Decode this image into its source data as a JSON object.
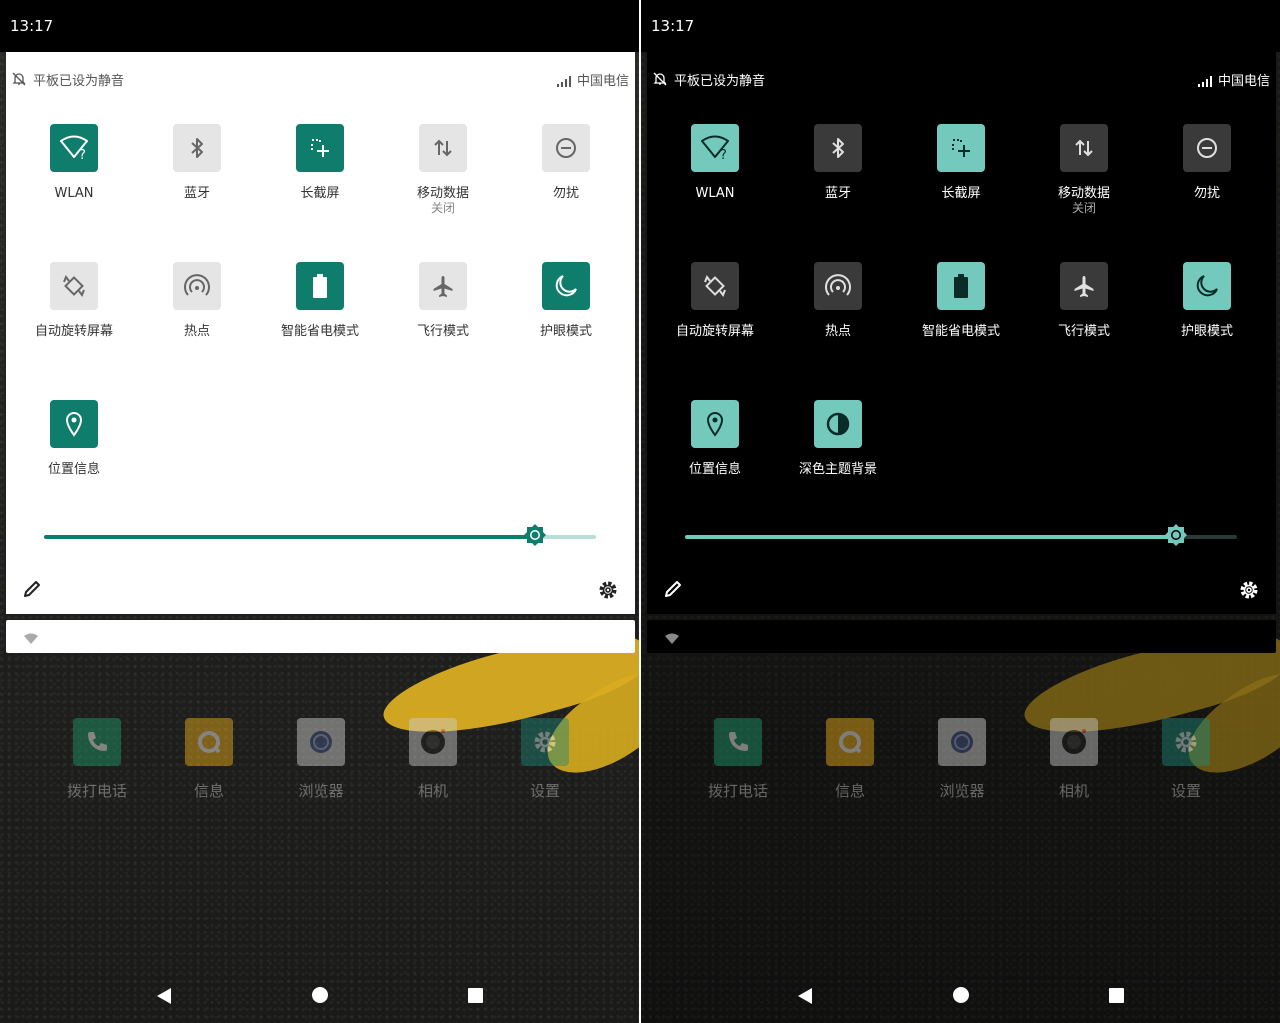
{
  "colors": {
    "accent_light": "#0f7d6b",
    "accent_dark": "#74c9bd"
  },
  "panels": [
    {
      "theme": "light",
      "status": {
        "time": "13:17"
      },
      "qs": {
        "silent_text": "平板已设为静音",
        "carrier": "中国电信"
      },
      "tiles": [
        {
          "label": "WLAN",
          "icon": "wifi-question-icon",
          "state": "on"
        },
        {
          "label": "蓝牙",
          "icon": "bluetooth-icon",
          "state": "off"
        },
        {
          "label": "长截屏",
          "icon": "long-screenshot-icon",
          "state": "on"
        },
        {
          "label": "移动数据",
          "sub": "关闭",
          "icon": "mobile-data-icon",
          "state": "off"
        },
        {
          "label": "勿扰",
          "icon": "do-not-disturb-icon",
          "state": "off"
        },
        {
          "label": "自动旋转屏幕",
          "icon": "auto-rotate-icon",
          "state": "off"
        },
        {
          "label": "热点",
          "icon": "hotspot-icon",
          "state": "off"
        },
        {
          "label": "智能省电模式",
          "icon": "battery-saver-icon",
          "state": "on"
        },
        {
          "label": "飞行模式",
          "icon": "airplane-icon",
          "state": "off"
        },
        {
          "label": "护眼模式",
          "icon": "night-mode-icon",
          "state": "on"
        },
        {
          "label": "位置信息",
          "icon": "location-icon",
          "state": "on"
        }
      ],
      "brightness": 0.89,
      "dock": [
        {
          "label": "拨打电话",
          "icon": "phone-icon",
          "color": "#1f9e6e"
        },
        {
          "label": "信息",
          "icon": "message-icon",
          "color": "#f3b21a"
        },
        {
          "label": "浏览器",
          "icon": "browser-icon",
          "color": "#d8d8d8"
        },
        {
          "label": "相机",
          "icon": "camera-icon",
          "color": "#cfcfcf"
        },
        {
          "label": "设置",
          "icon": "settings-icon",
          "color": "#1d8a7a"
        }
      ]
    },
    {
      "theme": "dark",
      "status": {
        "time": "13:17"
      },
      "qs": {
        "silent_text": "平板已设为静音",
        "carrier": "中国电信"
      },
      "tiles": [
        {
          "label": "WLAN",
          "icon": "wifi-question-icon",
          "state": "on"
        },
        {
          "label": "蓝牙",
          "icon": "bluetooth-icon",
          "state": "off"
        },
        {
          "label": "长截屏",
          "icon": "long-screenshot-icon",
          "state": "on"
        },
        {
          "label": "移动数据",
          "sub": "关闭",
          "icon": "mobile-data-icon",
          "state": "off"
        },
        {
          "label": "勿扰",
          "icon": "do-not-disturb-icon",
          "state": "off"
        },
        {
          "label": "自动旋转屏幕",
          "icon": "auto-rotate-icon",
          "state": "off"
        },
        {
          "label": "热点",
          "icon": "hotspot-icon",
          "state": "off"
        },
        {
          "label": "智能省电模式",
          "icon": "battery-saver-icon",
          "state": "on"
        },
        {
          "label": "飞行模式",
          "icon": "airplane-icon",
          "state": "off"
        },
        {
          "label": "护眼模式",
          "icon": "night-mode-icon",
          "state": "on"
        },
        {
          "label": "位置信息",
          "icon": "location-icon",
          "state": "on"
        },
        {
          "label": "深色主题背景",
          "icon": "dark-theme-icon",
          "state": "on"
        }
      ],
      "brightness": 0.89,
      "dock": [
        {
          "label": "拨打电话",
          "icon": "phone-icon",
          "color": "#1f9e6e"
        },
        {
          "label": "信息",
          "icon": "message-icon",
          "color": "#f3b21a"
        },
        {
          "label": "浏览器",
          "icon": "browser-icon",
          "color": "#d8d8d8"
        },
        {
          "label": "相机",
          "icon": "camera-icon",
          "color": "#cfcfcf"
        },
        {
          "label": "设置",
          "icon": "settings-icon",
          "color": "#1d8a7a"
        }
      ]
    }
  ]
}
